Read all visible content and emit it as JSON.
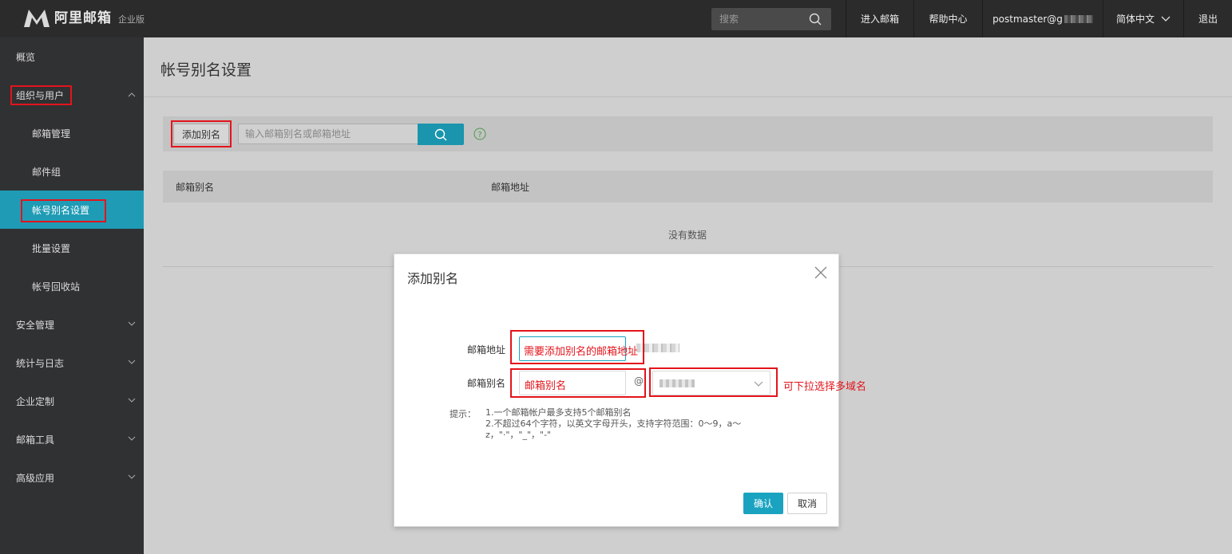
{
  "header": {
    "logo_text": "阿里邮箱",
    "edition": "企业版",
    "search_placeholder": "搜索",
    "nav": {
      "enter_mailbox": "进入邮箱",
      "help_center": "帮助中心",
      "account": "postmaster@g",
      "language": "简体中文",
      "logout": "退出"
    }
  },
  "sidebar": {
    "overview": "概览",
    "org_users": "组织与用户",
    "mailbox_mgmt": "邮箱管理",
    "mail_group": "邮件组",
    "alias_settings": "帐号别名设置",
    "batch_settings": "批量设置",
    "recycle_bin": "帐号回收站",
    "security": "安全管理",
    "stats_logs": "统计与日志",
    "customization": "企业定制",
    "mail_tools": "邮箱工具",
    "advanced": "高级应用"
  },
  "main": {
    "page_title": "帐号别名设置",
    "add_alias_button": "添加别名",
    "search_placeholder": "输入邮箱别名或邮箱地址",
    "table": {
      "columns": [
        "邮箱别名",
        "邮箱地址"
      ],
      "empty_text": "没有数据"
    }
  },
  "dialog": {
    "title": "添加别名",
    "address_label": "邮箱地址",
    "address_annotation": "需要添加别名的邮箱地址",
    "alias_label": "邮箱别名",
    "alias_annotation": "邮箱别名",
    "at_sign": "@",
    "domain_note": "可下拉选择多域名",
    "tip_label": "提示：",
    "tip_line1": "1.一个邮箱帐户最多支持5个邮箱别名",
    "tip_line2": "2.不超过64个字符，以英文字母开头，支持字符范围：0～9，a～z，\"·\"，\"_\"，\"-\"",
    "confirm": "确认",
    "cancel": "取消"
  },
  "colors": {
    "accent": "#1aa3c0",
    "sidebar_active": "#1f9bb5",
    "annotation_red": "#e3141b"
  }
}
